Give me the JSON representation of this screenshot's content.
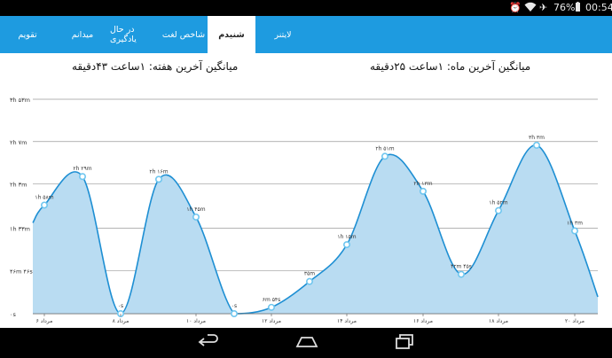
{
  "status_bar": {
    "battery": "76%",
    "time": "00:54",
    "icons": [
      "alarm-icon",
      "wifi-icon",
      "airplane-icon",
      "battery-icon"
    ]
  },
  "tabs": [
    {
      "label": "لایتنر",
      "active": false
    },
    {
      "label": "شنیدم",
      "active": true
    },
    {
      "label": "شاخص لغت",
      "active": false
    },
    {
      "label": "در حال یادگیری",
      "active": false
    },
    {
      "label": "میدانم",
      "active": false
    },
    {
      "label": "تقویم",
      "active": false
    }
  ],
  "summary": {
    "month": "میانگین آخرین ماه: ۱ساعت ۲۵دقیقه",
    "week": "میانگین آخرین هفته: ۱ساعت ۴۳دقیقه"
  },
  "chart_data": {
    "type": "area",
    "y_ticks": [
      "۳h ۵۳m",
      "۲h ۷m",
      "۲h ۳m",
      "۱h ۳۳m",
      "۴۶m ۴۶s",
      "۰s"
    ],
    "y_values_seconds": [
      13980,
      11220,
      8460,
      5580,
      2806,
      0
    ],
    "x_labels": [
      "۶ مرداد",
      "۸ مرداد",
      "۱۰ مرداد",
      "۱۲ مرداد",
      "۱۴ مرداد",
      "۱۶ مرداد",
      "۱۸ مرداد",
      "۲۰ مرداد"
    ],
    "points": [
      {
        "label": "۱h ۵۸m",
        "seconds": 7080
      },
      {
        "label": "۲h ۲۹m",
        "seconds": 8940
      },
      {
        "label": "۰s",
        "seconds": 0
      },
      {
        "label": "۲h ۱۶m",
        "seconds": 8760
      },
      {
        "label": "۱h ۴۵m",
        "seconds": 6300
      },
      {
        "label": "۰s",
        "seconds": 0
      },
      {
        "label": "۶m ۵۴s",
        "seconds": 414
      },
      {
        "label": "۳۵m",
        "seconds": 2100
      },
      {
        "label": "۱h ۱۵m",
        "seconds": 4500
      },
      {
        "label": "۲h ۵۱m",
        "seconds": 10260
      },
      {
        "label": "۲h ۱۳m",
        "seconds": 7980
      },
      {
        "label": "۴۲m ۴۵s",
        "seconds": 2565
      },
      {
        "label": "۱h ۵۲m",
        "seconds": 6720
      },
      {
        "label": "۳h ۳m",
        "seconds": 10980
      },
      {
        "label": "۱h ۳m",
        "seconds": 5400
      }
    ],
    "colors": {
      "line": "#1e8fd3",
      "fill": "#b9dcf2",
      "grid": "#9a9a9a",
      "point": "#ffffff"
    }
  },
  "nav": [
    "back-icon",
    "home-icon",
    "recent-apps-icon"
  ]
}
